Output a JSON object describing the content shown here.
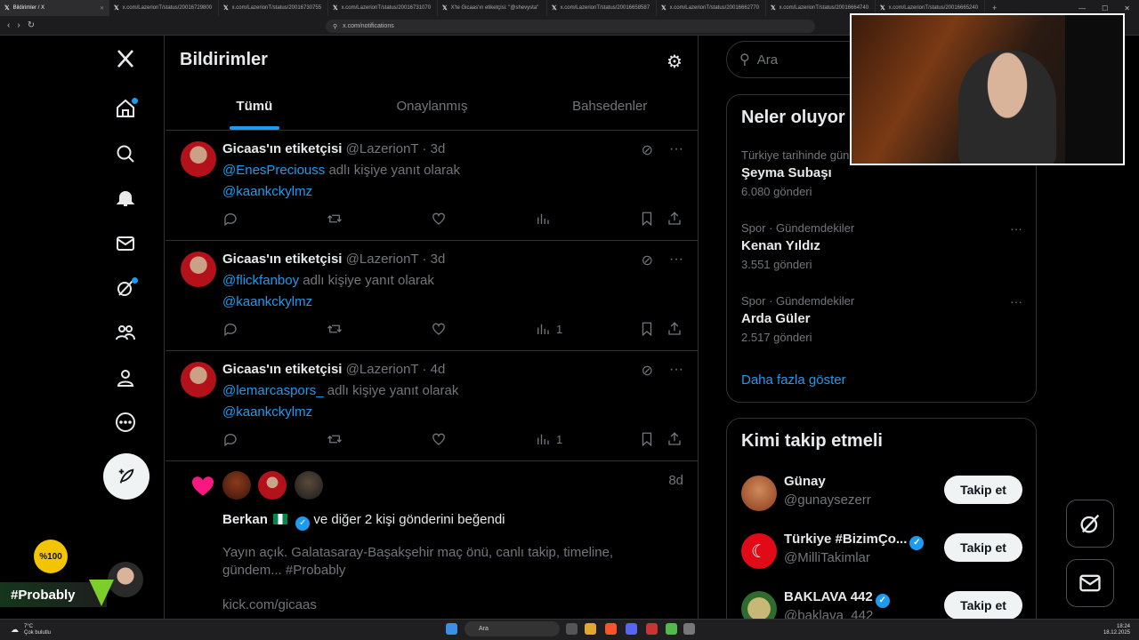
{
  "browser": {
    "tabs": [
      {
        "label": "Bildirimler / X",
        "active": true
      },
      {
        "label": "x.com/LazerionT/status/20016729800"
      },
      {
        "label": "x.com/LazerionT/status/20016730755"
      },
      {
        "label": "x.com/LazerionT/status/20016731070"
      },
      {
        "label": "X'te Gicaas'ın etiketçisi: \"@shevysta\""
      },
      {
        "label": "x.com/LazerionT/status/20016658587"
      },
      {
        "label": "x.com/LazerionT/status/20016662770"
      },
      {
        "label": "x.com/LazerionT/status/20016664740"
      },
      {
        "label": "x.com/LazerionT/status/20016665240"
      }
    ],
    "url": "x.com/notifications"
  },
  "page": {
    "title": "Bildirimler"
  },
  "notif_tabs": [
    "Tümü",
    "Onaylanmış",
    "Bahsedenler"
  ],
  "posts": [
    {
      "name": "Gicaas'ın etiketçisi",
      "handle": "@LazerionT · 3d",
      "mention": "@EnesPreciouss",
      "reply_text": "adlı kişiye yanıt olarak",
      "reply_to": "@kaankckylmz",
      "views": ""
    },
    {
      "name": "Gicaas'ın etiketçisi",
      "handle": "@LazerionT · 3d",
      "mention": "@flickfanboy",
      "reply_text": "adlı kişiye yanıt olarak",
      "reply_to": "@kaankckylmz",
      "views": "1"
    },
    {
      "name": "Gicaas'ın etiketçisi",
      "handle": "@LazerionT · 4d",
      "mention": "@lemarcaspors_",
      "reply_text": "adlı kişiye yanıt olarak",
      "reply_to": "@kaankckylmz",
      "views": "1"
    }
  ],
  "like_notif": {
    "age": "8d",
    "actor": "Berkan",
    "text": "ve diğer 2 kişi gönderini beğendi",
    "body": "Yayın açık. Galatasaray-Başakşehir maç önü, canlı takip, timeline, gündem... #Probably",
    "link": "kick.com/gicaas"
  },
  "search": {
    "placeholder": "Ara"
  },
  "trends": {
    "title": "Neler oluyor",
    "items": [
      {
        "meta": "Türkiye tarihinde gündemde",
        "name": "Şeyma Subaşı",
        "count": "6.080 gönderi"
      },
      {
        "meta": "Spor · Gündemdekiler",
        "name": "Kenan Yıldız",
        "count": "3.551 gönderi"
      },
      {
        "meta": "Spor · Gündemdekiler",
        "name": "Arda Güler",
        "count": "2.517 gönderi"
      }
    ],
    "more": "Daha fazla göster"
  },
  "who_to_follow": {
    "title": "Kimi takip etmeli",
    "items": [
      {
        "name": "Günay",
        "handle": "@gunaysezerr",
        "button": "Takip et",
        "color": "#8a3a1e"
      },
      {
        "name": "Türkiye #BizimÇo...",
        "handle": "@MilliTakimlar",
        "button": "Takip et",
        "color": "#e30a17"
      },
      {
        "name": "BAKLAVA 442",
        "handle": "@baklava_442",
        "button": "Takip et",
        "color": "#2e6b2e"
      }
    ]
  },
  "overlay": {
    "hashtag": "#Probably",
    "badge": "%100"
  },
  "taskbar": {
    "weather_temp": "7°C",
    "weather_text": "Çok bulutlu",
    "search": "Ara",
    "time": "18:24",
    "date": "18.12.2025"
  },
  "colors": {
    "accent": "#1d9bf0",
    "like": "#f91880",
    "bg": "#000000",
    "border": "#2f3336"
  }
}
